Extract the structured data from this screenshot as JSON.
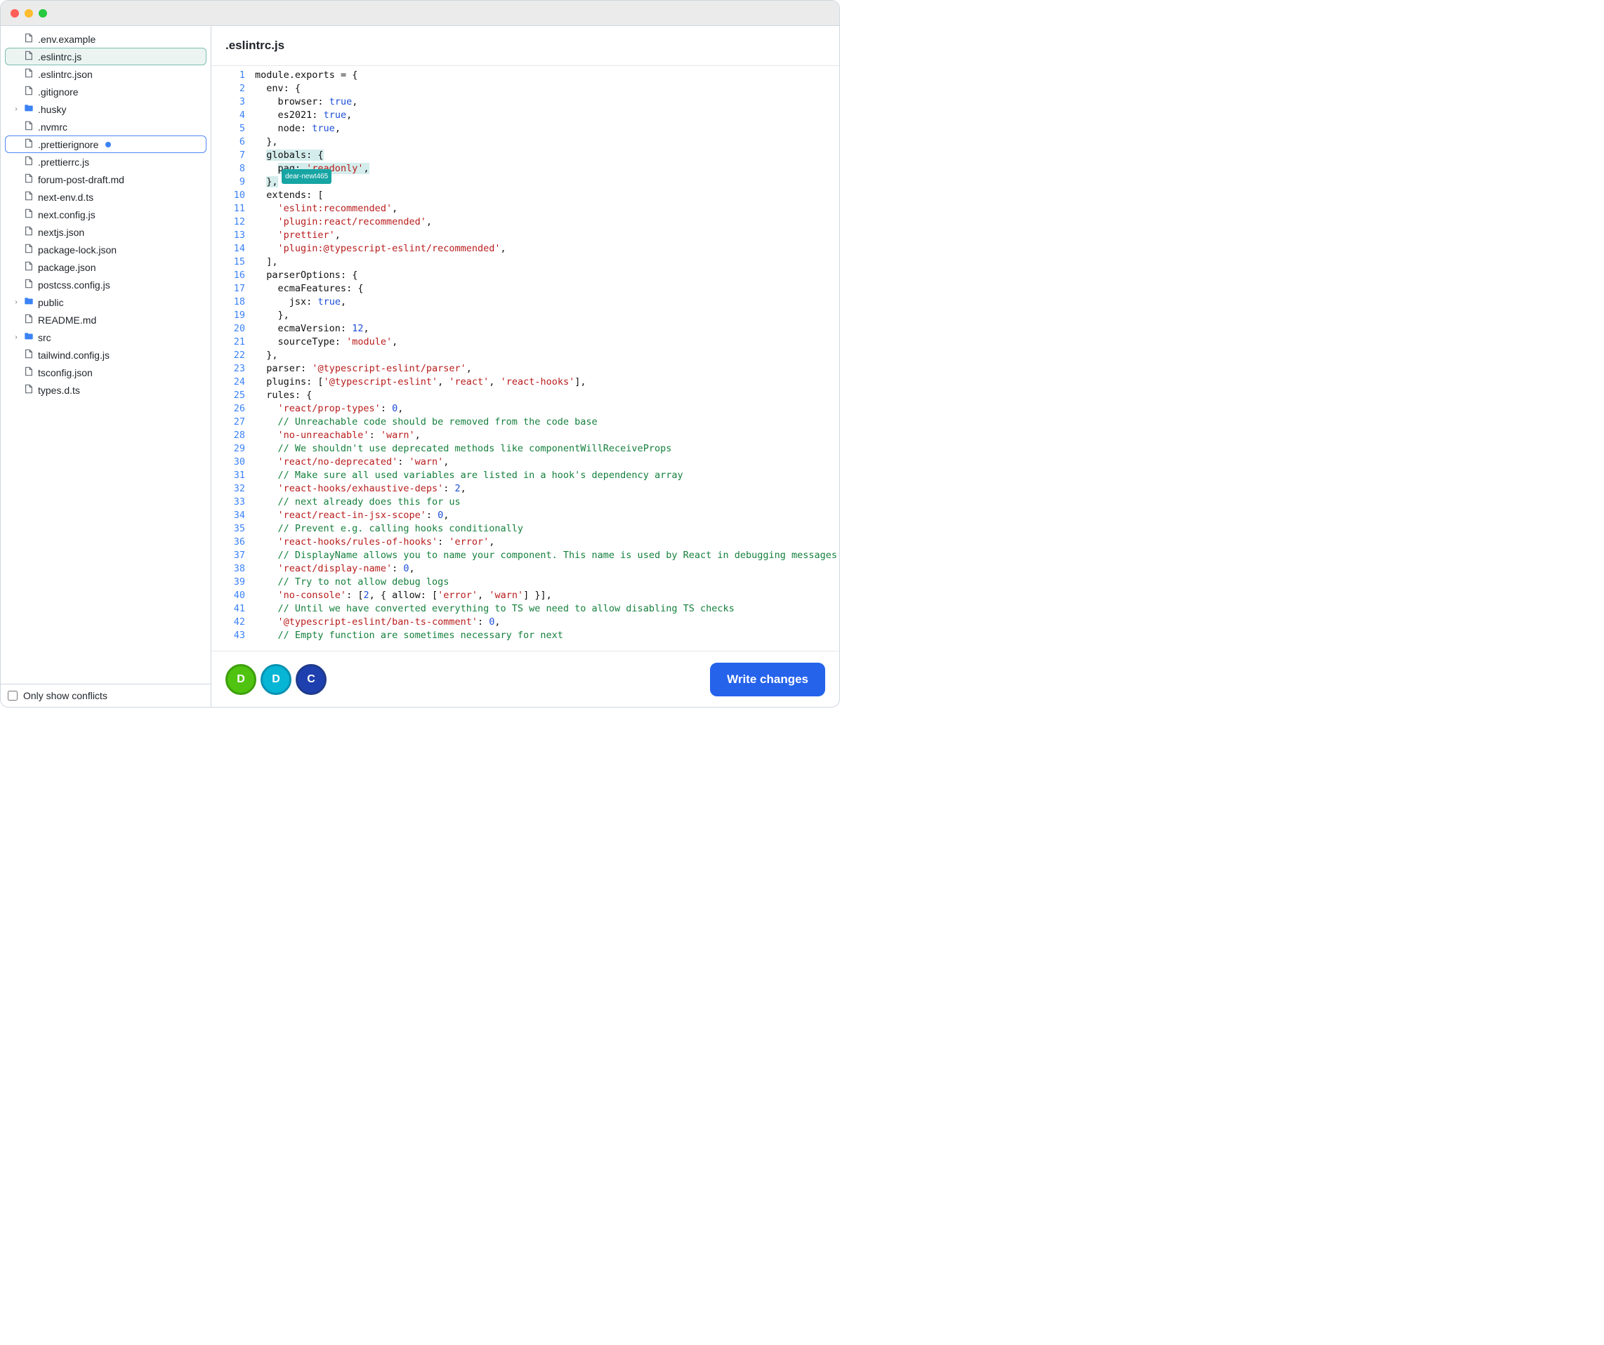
{
  "editor": {
    "filename": ".eslintrc.js"
  },
  "sidebar": {
    "only_conflicts_label": "Only show conflicts",
    "items": [
      {
        "name": ".env.example",
        "type": "file"
      },
      {
        "name": ".eslintrc.js",
        "type": "file",
        "selected": true
      },
      {
        "name": ".eslintrc.json",
        "type": "file"
      },
      {
        "name": ".gitignore",
        "type": "file"
      },
      {
        "name": ".husky",
        "type": "folder"
      },
      {
        "name": ".nvmrc",
        "type": "file"
      },
      {
        "name": ".prettierignore",
        "type": "file",
        "modified": true,
        "focused": true
      },
      {
        "name": ".prettierrc.js",
        "type": "file"
      },
      {
        "name": "forum-post-draft.md",
        "type": "file"
      },
      {
        "name": "next-env.d.ts",
        "type": "file"
      },
      {
        "name": "next.config.js",
        "type": "file"
      },
      {
        "name": "nextjs.json",
        "type": "file"
      },
      {
        "name": "package-lock.json",
        "type": "file"
      },
      {
        "name": "package.json",
        "type": "file"
      },
      {
        "name": "postcss.config.js",
        "type": "file"
      },
      {
        "name": "public",
        "type": "folder"
      },
      {
        "name": "README.md",
        "type": "file"
      },
      {
        "name": "src",
        "type": "folder"
      },
      {
        "name": "tailwind.config.js",
        "type": "file"
      },
      {
        "name": "tsconfig.json",
        "type": "file"
      },
      {
        "name": "types.d.ts",
        "type": "file"
      }
    ]
  },
  "collaborators": {
    "cursor_tag": "dear-newt465",
    "avatars": [
      {
        "initial": "D",
        "cls": "a1"
      },
      {
        "initial": "D",
        "cls": "a2"
      },
      {
        "initial": "C",
        "cls": "a3"
      }
    ]
  },
  "actions": {
    "write_changes": "Write changes"
  },
  "code": {
    "lines": [
      [
        [
          "key",
          "module"
        ],
        [
          "pun",
          "."
        ],
        [
          "key",
          "exports"
        ],
        [
          "pun",
          " = {"
        ]
      ],
      [
        [
          "pun",
          "  "
        ],
        [
          "key",
          "env"
        ],
        [
          "pun",
          ": {"
        ]
      ],
      [
        [
          "pun",
          "    "
        ],
        [
          "key",
          "browser"
        ],
        [
          "pun",
          ": "
        ],
        [
          "bool",
          "true"
        ],
        [
          "pun",
          ","
        ]
      ],
      [
        [
          "pun",
          "    "
        ],
        [
          "key",
          "es2021"
        ],
        [
          "pun",
          ": "
        ],
        [
          "bool",
          "true"
        ],
        [
          "pun",
          ","
        ]
      ],
      [
        [
          "pun",
          "    "
        ],
        [
          "key",
          "node"
        ],
        [
          "pun",
          ": "
        ],
        [
          "bool",
          "true"
        ],
        [
          "pun",
          ","
        ]
      ],
      [
        [
          "pun",
          "  },"
        ]
      ],
      [
        [
          "pun",
          "  "
        ],
        [
          "hl-start",
          ""
        ],
        [
          "key",
          "globals"
        ],
        [
          "pun",
          ": {"
        ],
        [
          "hl-end",
          ""
        ]
      ],
      [
        [
          "pun",
          "    "
        ],
        [
          "hl-start",
          ""
        ],
        [
          "key",
          "paq"
        ],
        [
          "pun",
          ": "
        ],
        [
          "str",
          "'readonly'"
        ],
        [
          "pun",
          ","
        ],
        [
          "hl-end",
          ""
        ]
      ],
      [
        [
          "pun",
          "  "
        ],
        [
          "hl-start",
          ""
        ],
        [
          "pun",
          "},"
        ],
        [
          "hl-end",
          ""
        ]
      ],
      [
        [
          "pun",
          "  "
        ],
        [
          "key",
          "extends"
        ],
        [
          "pun",
          ": ["
        ]
      ],
      [
        [
          "pun",
          "    "
        ],
        [
          "str",
          "'eslint:recommended'"
        ],
        [
          "pun",
          ","
        ]
      ],
      [
        [
          "pun",
          "    "
        ],
        [
          "str",
          "'plugin:react/recommended'"
        ],
        [
          "pun",
          ","
        ]
      ],
      [
        [
          "pun",
          "    "
        ],
        [
          "str",
          "'prettier'"
        ],
        [
          "pun",
          ","
        ]
      ],
      [
        [
          "pun",
          "    "
        ],
        [
          "str",
          "'plugin:@typescript-eslint/recommended'"
        ],
        [
          "pun",
          ","
        ]
      ],
      [
        [
          "pun",
          "  ],"
        ]
      ],
      [
        [
          "pun",
          "  "
        ],
        [
          "key",
          "parserOptions"
        ],
        [
          "pun",
          ": {"
        ]
      ],
      [
        [
          "pun",
          "    "
        ],
        [
          "key",
          "ecmaFeatures"
        ],
        [
          "pun",
          ": {"
        ]
      ],
      [
        [
          "pun",
          "      "
        ],
        [
          "key",
          "jsx"
        ],
        [
          "pun",
          ": "
        ],
        [
          "bool",
          "true"
        ],
        [
          "pun",
          ","
        ]
      ],
      [
        [
          "pun",
          "    },"
        ]
      ],
      [
        [
          "pun",
          "    "
        ],
        [
          "key",
          "ecmaVersion"
        ],
        [
          "pun",
          ": "
        ],
        [
          "num",
          "12"
        ],
        [
          "pun",
          ","
        ]
      ],
      [
        [
          "pun",
          "    "
        ],
        [
          "key",
          "sourceType"
        ],
        [
          "pun",
          ": "
        ],
        [
          "str",
          "'module'"
        ],
        [
          "pun",
          ","
        ]
      ],
      [
        [
          "pun",
          "  },"
        ]
      ],
      [
        [
          "pun",
          "  "
        ],
        [
          "key",
          "parser"
        ],
        [
          "pun",
          ": "
        ],
        [
          "str",
          "'@typescript-eslint/parser'"
        ],
        [
          "pun",
          ","
        ]
      ],
      [
        [
          "pun",
          "  "
        ],
        [
          "key",
          "plugins"
        ],
        [
          "pun",
          ": ["
        ],
        [
          "str",
          "'@typescript-eslint'"
        ],
        [
          "pun",
          ", "
        ],
        [
          "str",
          "'react'"
        ],
        [
          "pun",
          ", "
        ],
        [
          "str",
          "'react-hooks'"
        ],
        [
          "pun",
          "],"
        ]
      ],
      [
        [
          "pun",
          "  "
        ],
        [
          "key",
          "rules"
        ],
        [
          "pun",
          ": {"
        ]
      ],
      [
        [
          "pun",
          "    "
        ],
        [
          "str",
          "'react/prop-types'"
        ],
        [
          "pun",
          ": "
        ],
        [
          "num",
          "0"
        ],
        [
          "pun",
          ","
        ]
      ],
      [
        [
          "pun",
          "    "
        ],
        [
          "com",
          "// Unreachable code should be removed from the code base"
        ]
      ],
      [
        [
          "pun",
          "    "
        ],
        [
          "str",
          "'no-unreachable'"
        ],
        [
          "pun",
          ": "
        ],
        [
          "str",
          "'warn'"
        ],
        [
          "pun",
          ","
        ]
      ],
      [
        [
          "pun",
          "    "
        ],
        [
          "com",
          "// We shouldn't use deprecated methods like componentWillReceiveProps"
        ]
      ],
      [
        [
          "pun",
          "    "
        ],
        [
          "str",
          "'react/no-deprecated'"
        ],
        [
          "pun",
          ": "
        ],
        [
          "str",
          "'warn'"
        ],
        [
          "pun",
          ","
        ]
      ],
      [
        [
          "pun",
          "    "
        ],
        [
          "com",
          "// Make sure all used variables are listed in a hook's dependency array"
        ]
      ],
      [
        [
          "pun",
          "    "
        ],
        [
          "str",
          "'react-hooks/exhaustive-deps'"
        ],
        [
          "pun",
          ": "
        ],
        [
          "num",
          "2"
        ],
        [
          "pun",
          ","
        ]
      ],
      [
        [
          "pun",
          "    "
        ],
        [
          "com",
          "// next already does this for us"
        ]
      ],
      [
        [
          "pun",
          "    "
        ],
        [
          "str",
          "'react/react-in-jsx-scope'"
        ],
        [
          "pun",
          ": "
        ],
        [
          "num",
          "0"
        ],
        [
          "pun",
          ","
        ]
      ],
      [
        [
          "pun",
          "    "
        ],
        [
          "com",
          "// Prevent e.g. calling hooks conditionally"
        ]
      ],
      [
        [
          "pun",
          "    "
        ],
        [
          "str",
          "'react-hooks/rules-of-hooks'"
        ],
        [
          "pun",
          ": "
        ],
        [
          "str",
          "'error'"
        ],
        [
          "pun",
          ","
        ]
      ],
      [
        [
          "pun",
          "    "
        ],
        [
          "com",
          "// DisplayName allows you to name your component. This name is used by React in debugging messages."
        ]
      ],
      [
        [
          "pun",
          "    "
        ],
        [
          "str",
          "'react/display-name'"
        ],
        [
          "pun",
          ": "
        ],
        [
          "num",
          "0"
        ],
        [
          "pun",
          ","
        ]
      ],
      [
        [
          "pun",
          "    "
        ],
        [
          "com",
          "// Try to not allow debug logs"
        ]
      ],
      [
        [
          "pun",
          "    "
        ],
        [
          "str",
          "'no-console'"
        ],
        [
          "pun",
          ": ["
        ],
        [
          "num",
          "2"
        ],
        [
          "pun",
          ", { "
        ],
        [
          "key",
          "allow"
        ],
        [
          "pun",
          ": ["
        ],
        [
          "str",
          "'error'"
        ],
        [
          "pun",
          ", "
        ],
        [
          "str",
          "'warn'"
        ],
        [
          "pun",
          "] }],"
        ]
      ],
      [
        [
          "pun",
          "    "
        ],
        [
          "com",
          "// Until we have converted everything to TS we need to allow disabling TS checks"
        ]
      ],
      [
        [
          "pun",
          "    "
        ],
        [
          "str",
          "'@typescript-eslint/ban-ts-comment'"
        ],
        [
          "pun",
          ": "
        ],
        [
          "num",
          "0"
        ],
        [
          "pun",
          ","
        ]
      ],
      [
        [
          "pun",
          "    "
        ],
        [
          "com",
          "// Empty function are sometimes necessary for next"
        ]
      ]
    ]
  }
}
